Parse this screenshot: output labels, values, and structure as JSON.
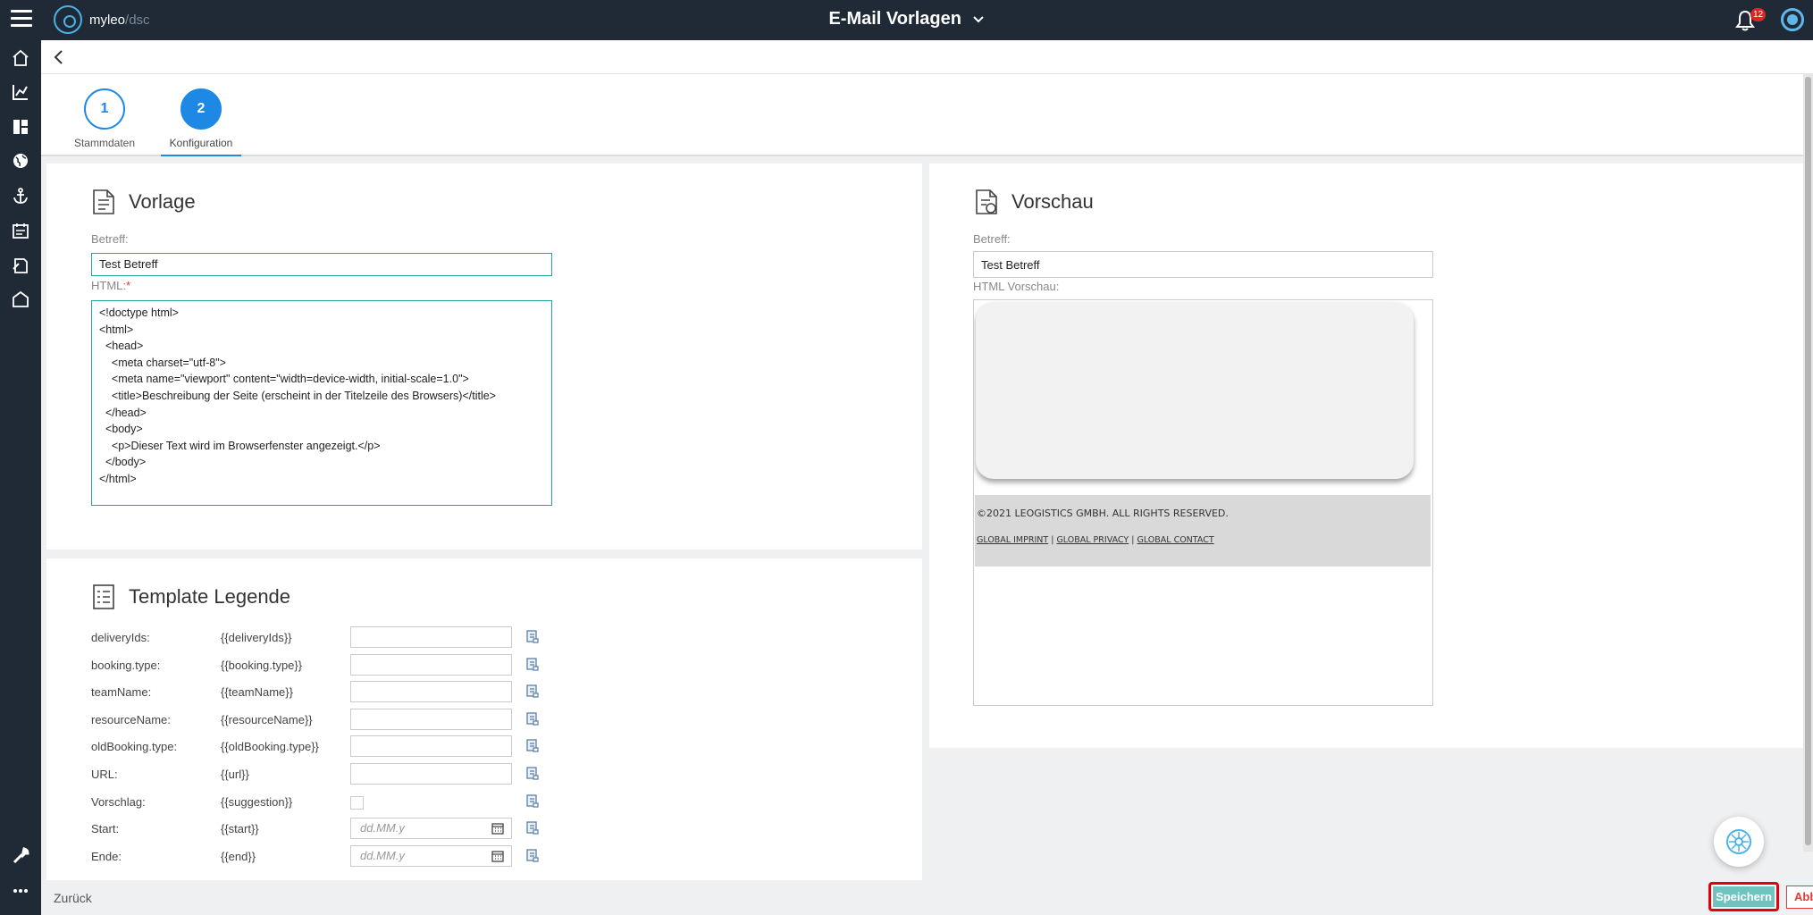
{
  "header": {
    "logo_text": "myleo",
    "logo_sep": "/",
    "logo_sub": "dsc",
    "title": "E-Mail Vorlagen",
    "notification_count": "12"
  },
  "sidebar": {
    "icons": [
      "home-icon",
      "chart-icon",
      "dashboard-icon",
      "globe-icon",
      "anchor-icon",
      "calendar-list-icon",
      "document-icon",
      "warehouse-icon",
      "wrench-icon",
      "more-icon"
    ]
  },
  "steps": [
    {
      "number": "1",
      "label": "Stammdaten"
    },
    {
      "number": "2",
      "label": "Konfiguration"
    }
  ],
  "vorlage": {
    "title": "Vorlage",
    "betreff_label": "Betreff:",
    "betreff_value": "Test Betreff",
    "html_label": "HTML:",
    "html_required": "*",
    "html_code": "<!doctype html>\n<html>\n  <head>\n    <meta charset=\"utf-8\">\n    <meta name=\"viewport\" content=\"width=device-width, initial-scale=1.0\">\n    <title>Beschreibung der Seite (erscheint in der Titelzeile des Browsers)</title>\n  </head>\n  <body>\n    <p>Dieser Text wird im Browserfenster angezeigt.</p>\n  </body>\n</html>"
  },
  "vorschau": {
    "title": "Vorschau",
    "betreff_label": "Betreff:",
    "betreff_value": "Test Betreff",
    "html_label": "HTML Vorschau:",
    "footer_copyright": "©2021 LEOGISTICS GMBH. ALL RIGHTS RESERVED.",
    "footer_links": [
      "GLOBAL IMPRINT",
      "GLOBAL PRIVACY",
      "GLOBAL CONTACT"
    ],
    "footer_link_sep": "|"
  },
  "legend": {
    "title": "Template Legende",
    "rows": [
      {
        "key": "deliveryIds:",
        "var": "{{deliveryIds}}",
        "type": "text",
        "placeholder": ""
      },
      {
        "key": "booking.type:",
        "var": "{{booking.type}}",
        "type": "text",
        "placeholder": ""
      },
      {
        "key": "teamName:",
        "var": "{{teamName}}",
        "type": "text",
        "placeholder": ""
      },
      {
        "key": "resourceName:",
        "var": "{{resourceName}}",
        "type": "text",
        "placeholder": ""
      },
      {
        "key": "oldBooking.type:",
        "var": "{{oldBooking.type}}",
        "type": "text",
        "placeholder": ""
      },
      {
        "key": "URL:",
        "var": "{{url}}",
        "type": "text",
        "placeholder": ""
      },
      {
        "key": "Vorschlag:",
        "var": "{{suggestion}}",
        "type": "checkbox",
        "placeholder": ""
      },
      {
        "key": "Start:",
        "var": "{{start}}",
        "type": "date",
        "placeholder": "dd.MM.y"
      },
      {
        "key": "Ende:",
        "var": "{{end}}",
        "type": "date",
        "placeholder": "dd.MM.y"
      }
    ]
  },
  "footer": {
    "back_label": "Zurück",
    "save_label": "Speichern",
    "cancel_label": "Abbrechen"
  },
  "colors": {
    "topbar": "#1f2a36",
    "accent": "#1e88e5",
    "input_border": "#26a69a",
    "save": "#6fc4c0",
    "cancel": "#e53935"
  }
}
